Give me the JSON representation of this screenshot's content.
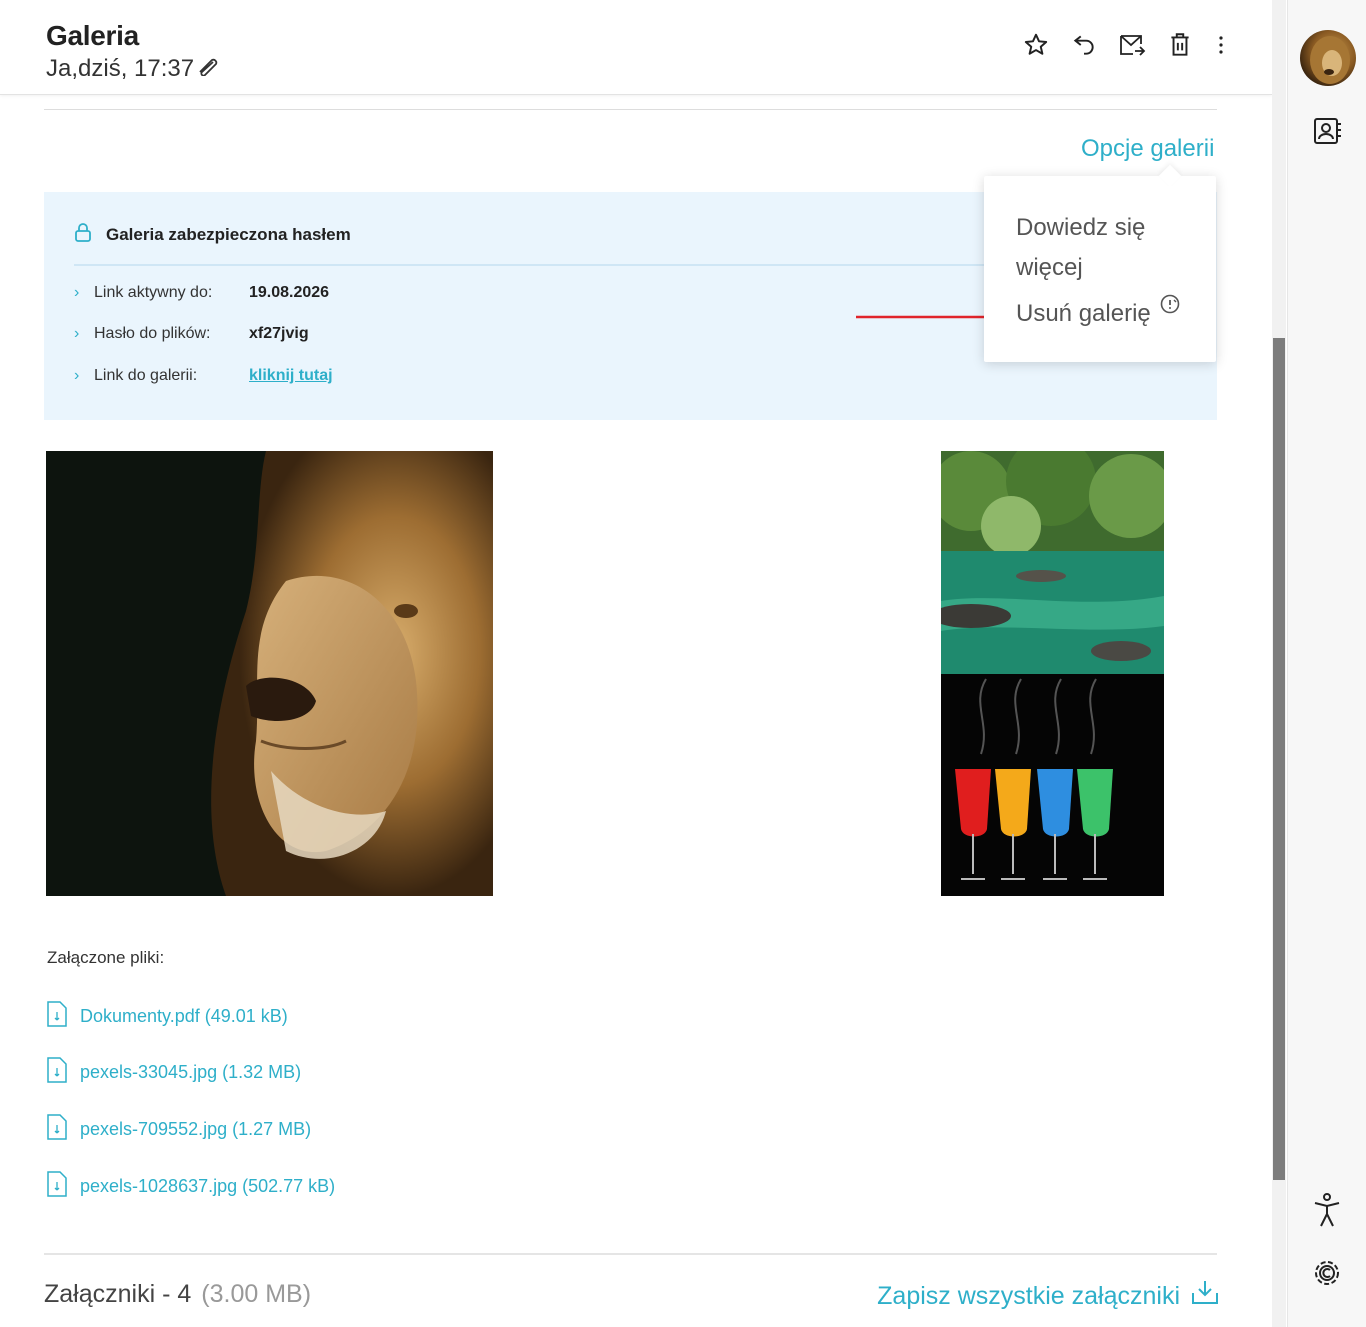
{
  "header": {
    "title": "Galeria",
    "subtitle": "Ja,dziś, 17:37"
  },
  "toolbar": {
    "icons": [
      "star-icon",
      "undo-icon",
      "move-mail-icon",
      "delete-icon",
      "more-vertical-icon"
    ]
  },
  "gallery_options": {
    "label": "Opcje galerii",
    "menu": [
      "Dowiedz się",
      "więcej",
      "Usuń galerię"
    ]
  },
  "infobox": {
    "heading": "Galeria zabezpieczona hasłem",
    "rows": [
      {
        "label": "Link aktywny do:",
        "value": "19.08.2026"
      },
      {
        "label": "Hasło do plików:",
        "value": "xf27jvig"
      },
      {
        "label": "Link do galerii:",
        "value": "kliknij tutaj"
      }
    ]
  },
  "attachments": {
    "label": "Załączone pliki:",
    "files": [
      "Dokumenty.pdf (49.01 kB)",
      "pexels-33045.jpg (1.32 MB)",
      "pexels-709552.jpg (1.27 MB)",
      "pexels-1028637.jpg (502.77 kB)"
    ]
  },
  "footer": {
    "count": "Załączniki - 4",
    "size": "(3.00 MB)",
    "save_all": "Zapisz wszystkie załączniki"
  },
  "colors": {
    "accent": "#2eafc9",
    "infobox_bg": "#eaf5fd",
    "arrow": "#e0242b"
  }
}
